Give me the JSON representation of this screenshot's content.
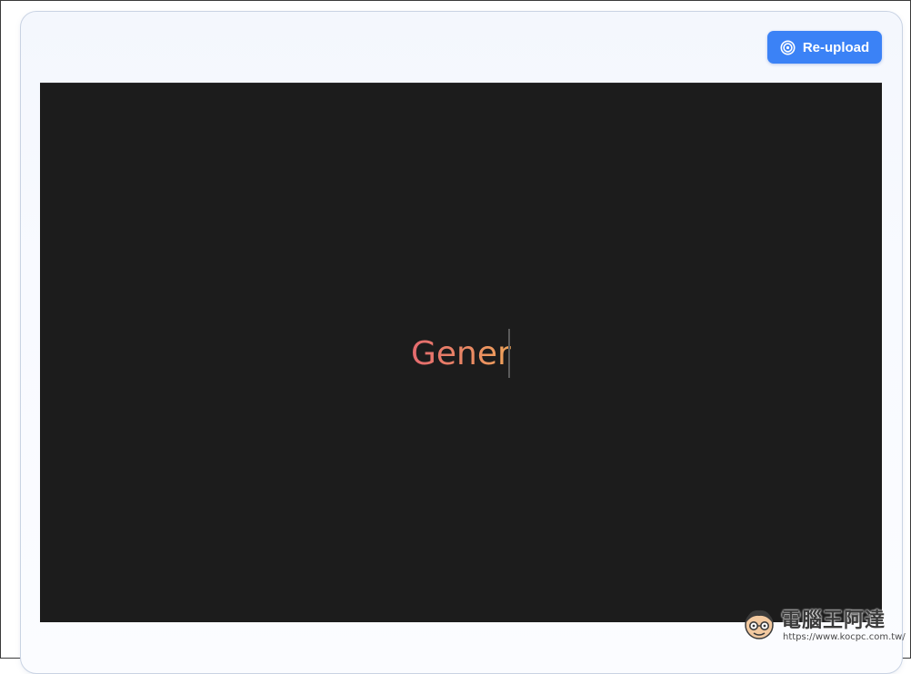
{
  "toolbar": {
    "reupload_label": "Re-upload",
    "reupload_icon": "target-icon"
  },
  "viewer": {
    "typed_text": "Gener",
    "gradient_start": "#e56a6f",
    "gradient_end": "#f0a45a",
    "background": "#1c1c1c"
  },
  "watermark": {
    "title": "電腦王阿達",
    "url": "https://www.kocpc.com.tw/"
  },
  "colors": {
    "accent": "#3b82f6"
  }
}
